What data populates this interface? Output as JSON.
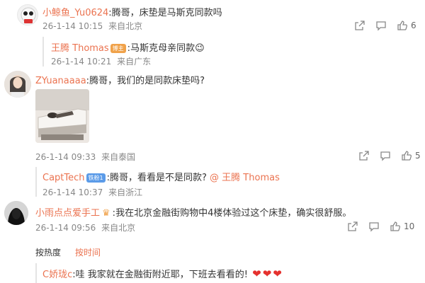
{
  "comments": [
    {
      "user": "小鲸鱼_Yu0624",
      "text": "腾哥，床垫是马斯克同款吗",
      "time": "26-1-14 10:15",
      "location": "来自北京",
      "likes": "6"
    },
    {
      "user": "ZYuanaaaa",
      "text": "腾哥，我们的是同款床垫吗?",
      "time": "26-1-14 09:33",
      "location": "来自泰国",
      "likes": "5"
    },
    {
      "user": "小雨点点爱手工",
      "text": "我在北京金融街购物中4楼体验过这个床垫，确实很舒服。",
      "time": "26-1-14 09:56",
      "location": "来自北京",
      "likes": "10"
    }
  ],
  "replies": [
    {
      "user": "王腾 Thomas",
      "badge": "博主",
      "text": "马斯克母亲同款",
      "emoji": "😉",
      "time": "26-1-14 10:21",
      "location": "来自广东"
    },
    {
      "user": "CaptTech",
      "badge": "铁粉1",
      "text": "腾哥，看看是不是同款?",
      "mention": "@ 王腾 Thomas",
      "time": "26-1-14 10:37",
      "location": "来自浙江"
    }
  ],
  "sort": {
    "by_hot": "按热度",
    "by_time": "按时间"
  },
  "bottom": {
    "user": "C娇珑c",
    "text": "哇 我家就在金融街附近耶，下班去看看的!"
  },
  "colors": {
    "username": "#eb7350",
    "mention": "#eb7350",
    "badge_blue": "#5b9be8",
    "heart": "#e5312e"
  }
}
